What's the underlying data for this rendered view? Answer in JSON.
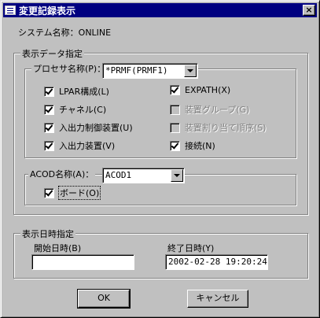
{
  "window": {
    "title": "変更記録表示",
    "close": "×"
  },
  "system_name_label": "システム名称：ONLINE",
  "display_data_group": {
    "legend": "表示データ指定",
    "processor": {
      "label": "プロセサ名称(P)：",
      "value": "*PRMF(PRMF1)"
    },
    "checkboxes": [
      {
        "label": "LPAR構成(L)",
        "checked": true,
        "enabled": true
      },
      {
        "label": "チャネル(C)",
        "checked": true,
        "enabled": true
      },
      {
        "label": "入出力制御装置(U)",
        "checked": true,
        "enabled": true
      },
      {
        "label": "入出力装置(V)",
        "checked": true,
        "enabled": true
      },
      {
        "label": "EXPATH(X)",
        "checked": true,
        "enabled": true
      },
      {
        "label": "装置グループ(G)",
        "checked": false,
        "enabled": false
      },
      {
        "label": "装置割り当て順序(S)",
        "checked": false,
        "enabled": false
      },
      {
        "label": "接続(N)",
        "checked": true,
        "enabled": true
      }
    ],
    "acod": {
      "label": "ACOD名称(A)：",
      "value": "ACOD1",
      "board": {
        "label": "ボード(O)",
        "checked": true
      }
    }
  },
  "date_group": {
    "legend": "表示日時指定",
    "start_label": "開始日時(B)",
    "start_value": "",
    "end_label": "終了日時(Y)",
    "end_value": "2002-02-28 19:20:24"
  },
  "buttons": {
    "ok": "OK",
    "cancel": "キャンセル"
  }
}
